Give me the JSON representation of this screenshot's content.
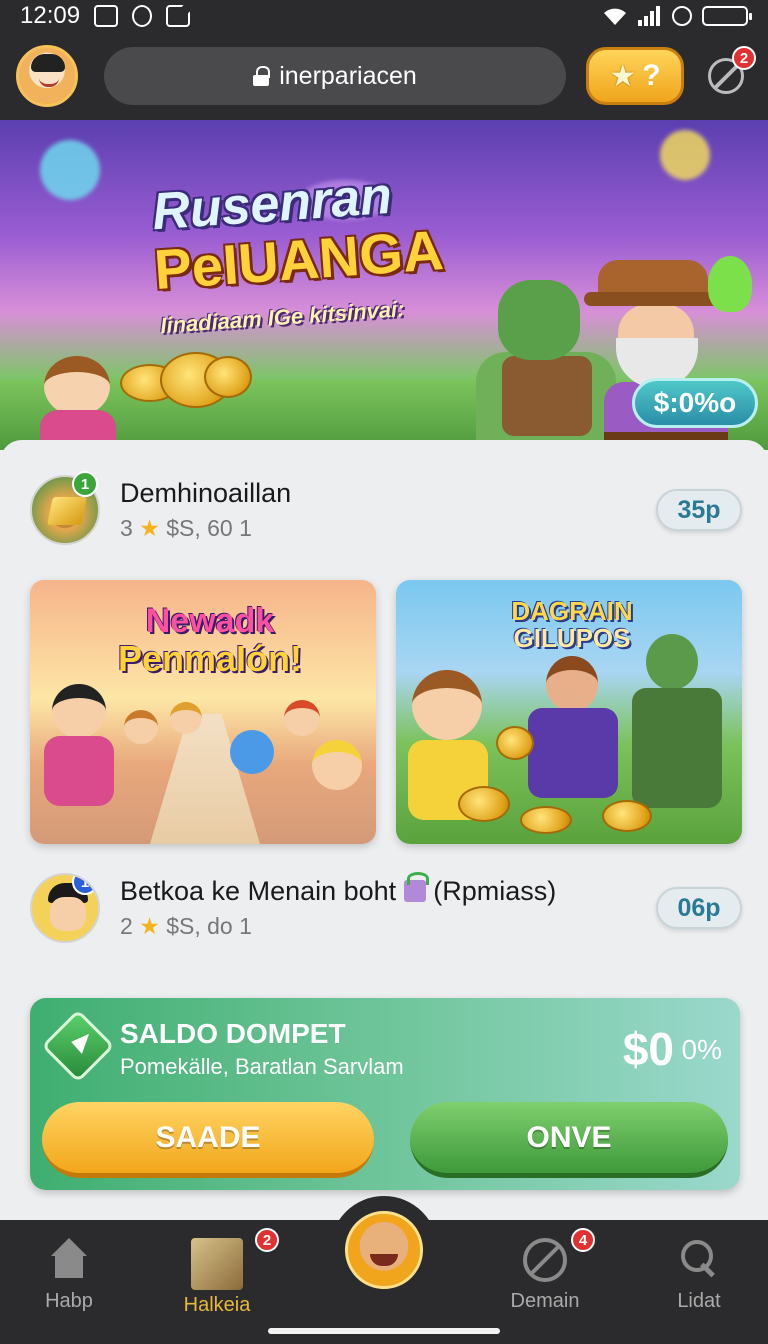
{
  "status_bar": {
    "time": "12:09"
  },
  "top_bar": {
    "url": "inerpariacen",
    "reward_label": "?",
    "tool_badge": "2"
  },
  "banner": {
    "title_line1": "Rusenran",
    "title_line2": "PeIUANGA",
    "subtitle": "Iinadiaam IGe kitsinvai:",
    "pill_label": "$:0%o"
  },
  "list": [
    {
      "title": "Demhinoaillan",
      "rank": "3",
      "sub": "$S, 60 1",
      "badge": "1",
      "pill": "35p"
    },
    {
      "title": "Betkoa ke Menain boht",
      "title_suffix": "(Rpmiass)",
      "rank": "2",
      "sub": "$S, do 1",
      "badge": "1",
      "pill": "06p"
    }
  ],
  "tiles": [
    {
      "line1": "Newadk",
      "line2": "PenmaIón!"
    },
    {
      "line1": "DAGRAIN",
      "line2": "GILUPOS"
    }
  ],
  "wallet": {
    "title": "SALDO DOMPET",
    "subtitle": "Pomekälle, Baratlan Sarvlam",
    "amount": "$0",
    "percent": "0%",
    "save_label": "SAADE",
    "move_label": "ONVE"
  },
  "bottom_nav": {
    "items": [
      {
        "label": "Habp",
        "badge": ""
      },
      {
        "label": "Halkeia",
        "badge": "2"
      },
      {
        "label": "Demain",
        "badge": "4"
      },
      {
        "label": "Lidat",
        "badge": ""
      }
    ]
  },
  "colors": {
    "bar_bg": "#2b2b2d",
    "accent_gold": "#f0a51c",
    "accent_green": "#3e9a3a",
    "badge_red": "#e23131"
  }
}
